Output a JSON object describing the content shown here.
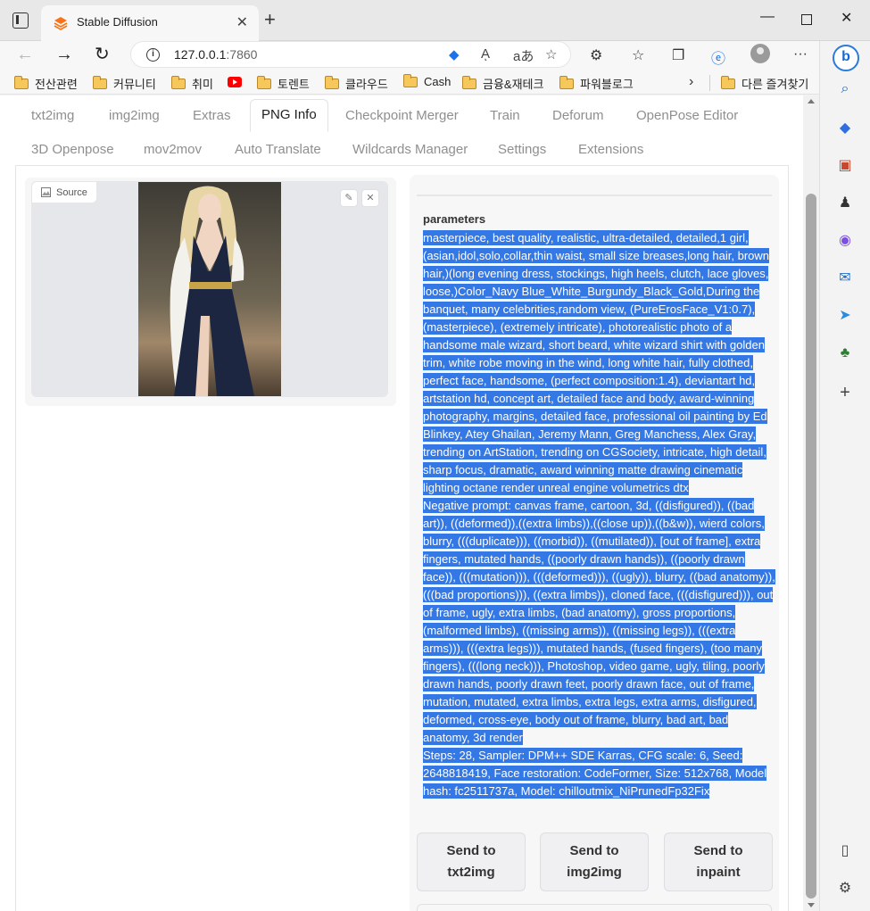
{
  "browser": {
    "tab_title": "Stable Diffusion",
    "url_host": "127.0.0.1",
    "url_port": ":7860",
    "reader_label": "Aͅ",
    "translate_label": "aあ"
  },
  "bookmarks": [
    {
      "label": "전산관련",
      "type": "folder"
    },
    {
      "label": "커뮤니티",
      "type": "folder"
    },
    {
      "label": "취미",
      "type": "folder"
    },
    {
      "label": "",
      "type": "youtube"
    },
    {
      "label": "토렌트",
      "type": "folder"
    },
    {
      "label": "클라우드",
      "type": "folder"
    },
    {
      "label": "Cash",
      "type": "folder"
    },
    {
      "label": "금융&재테크",
      "type": "folder"
    },
    {
      "label": "파워블로그",
      "type": "folder"
    }
  ],
  "other_bookmarks": "다른 즐겨찾기",
  "tabs_row1": [
    "txt2img",
    "img2img",
    "Extras",
    "PNG Info",
    "Checkpoint Merger",
    "Train",
    "Deforum",
    "OpenPose Editor"
  ],
  "tabs_row2": [
    "3D Openpose",
    "mov2mov",
    "Auto Translate",
    "Wildcards Manager",
    "Settings",
    "Extensions"
  ],
  "active_tab": "PNG Info",
  "image_panel": {
    "source_label": "Source"
  },
  "parameters": {
    "label": "parameters",
    "text": "masterpiece, best quality, realistic, ultra-detailed, detailed,1 girl,(asian,idol,solo,collar,thin waist, small size breases,long hair, brown hair,)(long evening dress, stockings, high heels, clutch, lace gloves, loose,)Color_Navy Blue_White_Burgundy_Black_Gold,During the banquet, many celebrities,random view, (PureErosFace_V1:0.7), (masterpiece), (extremely intricate), photorealistic photo of a handsome male wizard, short beard, white wizard shirt with golden trim, white robe moving in the wind, long white hair, fully clothed, perfect face, handsome, (perfect composition:1.4), deviantart hd, artstation hd, concept art, detailed face and body, award-winning photography, margins, detailed face, professional oil painting by Ed Blinkey, Atey Ghailan, Jeremy Mann, Greg Manchess, Alex Gray, trending on ArtStation, trending on CGSociety, intricate, high detail, sharp focus, dramatic, award winning matte drawing cinematic lighting octane render unreal engine volumetrics dtx",
    "negative": "Negative prompt: canvas frame, cartoon, 3d, ((disfigured)), ((bad art)), ((deformed)),((extra limbs)),((close up)),((b&w)), wierd colors, blurry, (((duplicate))), ((morbid)), ((mutilated)), [out of frame], extra fingers, mutated hands, ((poorly drawn hands)), ((poorly drawn face)), (((mutation))), (((deformed))), ((ugly)), blurry, ((bad anatomy)), (((bad proportions))), ((extra limbs)), cloned face, (((disfigured))), out of frame, ugly, extra limbs, (bad anatomy), gross proportions, (malformed limbs), ((missing arms)), ((missing legs)), (((extra arms))), (((extra legs))), mutated hands, (fused fingers), (too many fingers), (((long neck))), Photoshop, video game, ugly, tiling, poorly drawn hands, poorly drawn feet, poorly drawn face, out of frame, mutation, mutated, extra limbs, extra legs, extra arms, disfigured, deformed, cross-eye, body out of frame, blurry, bad art, bad anatomy, 3d render",
    "settings": "Steps: 28, Sampler: DPM++ SDE Karras, CFG scale: 6, Seed: 2648818419, Face restoration: CodeFormer, Size: 512x768, Model hash: fc2511737a, Model: chilloutmix_NiPrunedFp32Fix"
  },
  "send_buttons": [
    {
      "line1": "Send to",
      "line2": "txt2img"
    },
    {
      "line1": "Send to",
      "line2": "img2img"
    },
    {
      "line1": "Send to",
      "line2": "inpaint"
    }
  ],
  "colors": {
    "selection": "#3478e5",
    "accent": "#f97316"
  }
}
